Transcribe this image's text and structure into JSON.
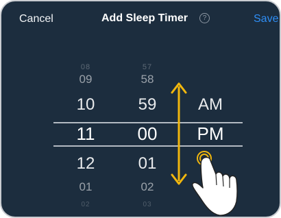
{
  "header": {
    "cancel_label": "Cancel",
    "title": "Add Sleep Timer",
    "help_glyph": "?",
    "save_label": "Save"
  },
  "hour_picker": {
    "items": [
      "08",
      "09",
      "10",
      "11",
      "12",
      "01",
      "02"
    ],
    "selected": "11"
  },
  "minute_picker": {
    "items": [
      "57",
      "58",
      "59",
      "00",
      "01",
      "02",
      "03"
    ],
    "selected": "00"
  },
  "period_picker": {
    "items": [
      "AM",
      "PM"
    ],
    "selected": "PM"
  },
  "colors": {
    "background": "#1c2d3e",
    "accent": "#2f8ef5",
    "scroll_arrow": "#f1b70e",
    "text": "#ffffff"
  },
  "icons": {
    "scroll_hint": "vertical-double-arrow-icon",
    "gesture": "hand-swipe-icon",
    "help": "help-circle-icon"
  }
}
